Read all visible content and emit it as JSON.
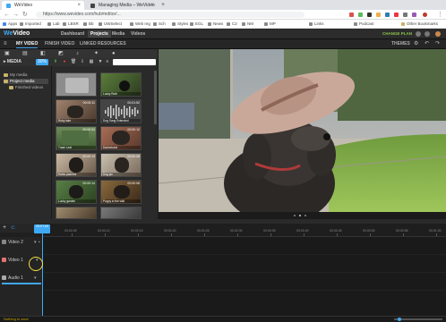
{
  "browser": {
    "tabs": [
      {
        "title": "WeVideo",
        "active": true,
        "color": "#3fa9f5"
      },
      {
        "title": "Managing Media – WeVideo",
        "active": false,
        "color": "#444444"
      }
    ],
    "url": "https://www.wevideo.com/hub#editor/...",
    "bookmarks": [
      "Apps",
      "Imported",
      "Lab",
      "LBSR",
      "Bb",
      "UWSelect",
      "Web reg",
      "Sch",
      "Styles",
      "EGL",
      "News",
      "C2",
      "NM",
      "MP",
      "Links",
      "Podcast",
      "Other Bookmarks"
    ]
  },
  "app": {
    "logo_we": "We",
    "logo_video": "Video",
    "nav": [
      "Dashboard",
      "Projects",
      "Media",
      "Videos"
    ],
    "active_nav": "Projects",
    "change_plan": "CHANGE PLAN"
  },
  "subtabs": {
    "items": [
      "MY VIDEO",
      "FINISH VIDEO",
      "LINKED RESOURCES"
    ],
    "right": "THEMES"
  },
  "media_panel": {
    "header": "MEDIA",
    "tree": [
      {
        "label": "My media",
        "selected": false
      },
      {
        "label": "Project media",
        "selected": true
      },
      {
        "label": "Finished videos",
        "selected": false
      }
    ],
    "zoom_label": "30%",
    "thumbnails": [
      {
        "name": "",
        "duration": ""
      },
      {
        "name": "Lucky Ruth",
        "duration": ""
      },
      {
        "name": "Ruby lake",
        "duration": "00:00:11"
      },
      {
        "name": "Dog Song Extended",
        "duration": "00:01:52"
      },
      {
        "name": "Trash Leal",
        "duration": "00:00:04"
      },
      {
        "name": "Dachshund",
        "duration": "00:00:12"
      },
      {
        "name": "Holes patches",
        "duration": "00:00:13"
      },
      {
        "name": "Dog pic",
        "duration": "00:00:08"
      },
      {
        "name": "Lucky garden",
        "duration": "00:00:14"
      },
      {
        "name": "Puppy in the wild",
        "duration": "00:00:08"
      },
      {
        "name": "",
        "duration": ""
      },
      {
        "name": "",
        "duration": ""
      }
    ]
  },
  "timeline": {
    "playhead": "00:00:00",
    "ticks": [
      "00:00:05",
      "00:00:10",
      "00:00:15",
      "00:00:20",
      "00:00:25",
      "00:00:30",
      "00:00:35",
      "00:00:40",
      "00:00:45",
      "00:00:50",
      "00:00:55",
      "00:01:00"
    ],
    "tracks": [
      "Video 2",
      "Video 1",
      "Audio 1"
    ],
    "status": "Nothing to save"
  }
}
